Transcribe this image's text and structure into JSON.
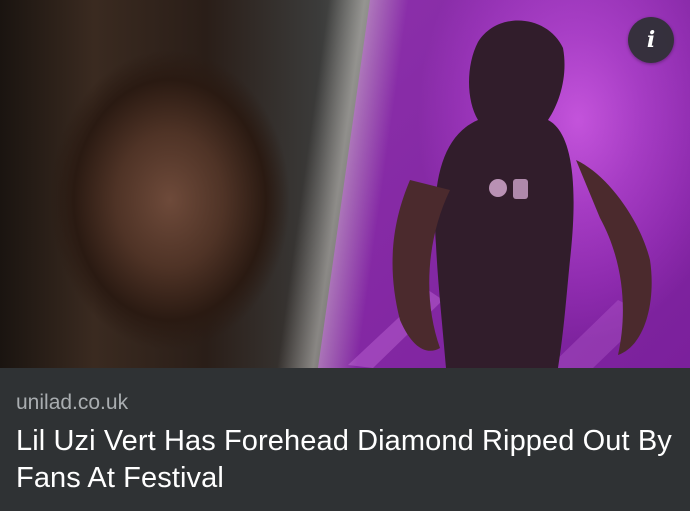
{
  "card": {
    "image": {
      "left_photo_alt": "Close-up selfie portrait",
      "right_photo_alt": "Performer on stage with purple lighting",
      "colors": {
        "stage_purple": "#a137c0",
        "divider_light": "#d8d3ce"
      },
      "info_button": {
        "icon": "info-icon",
        "glyph": "i"
      }
    },
    "caption": {
      "source": "unilad.co.uk",
      "headline": "Lil Uzi Vert Has Forehead Diamond Ripped Out By Fans At Festival"
    }
  }
}
